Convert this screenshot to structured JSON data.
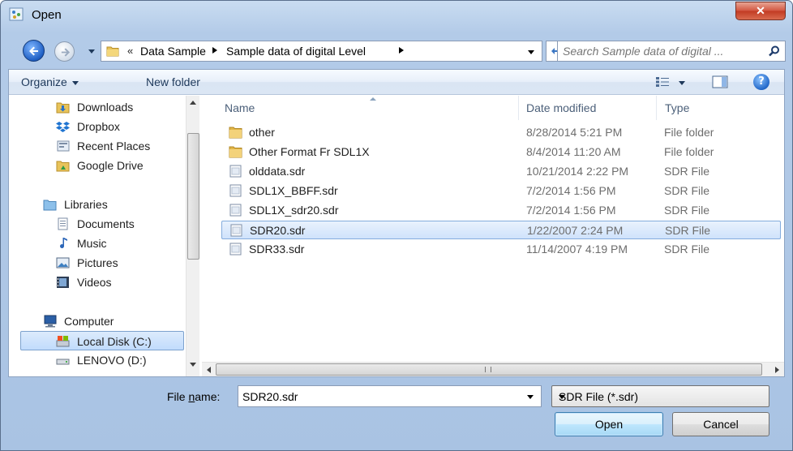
{
  "window": {
    "title": "Open"
  },
  "address": {
    "overflow": "«",
    "crumbs": [
      "Data Sample",
      "Sample data of digital Level"
    ]
  },
  "search": {
    "placeholder": "Search Sample data of digital ..."
  },
  "toolbar": {
    "organize": "Organize",
    "new_folder": "New folder"
  },
  "nav": {
    "items": [
      {
        "label": "Downloads",
        "icon": "downloads-folder-icon"
      },
      {
        "label": "Dropbox",
        "icon": "dropbox-icon"
      },
      {
        "label": "Recent Places",
        "icon": "recent-places-icon"
      },
      {
        "label": "Google Drive",
        "icon": "google-drive-icon"
      },
      {
        "label": "Libraries",
        "icon": "libraries-icon"
      },
      {
        "label": "Documents",
        "icon": "documents-icon"
      },
      {
        "label": "Music",
        "icon": "music-icon"
      },
      {
        "label": "Pictures",
        "icon": "pictures-icon"
      },
      {
        "label": "Videos",
        "icon": "videos-icon"
      },
      {
        "label": "Computer",
        "icon": "computer-icon"
      },
      {
        "label": "Local Disk (C:)",
        "icon": "local-disk-icon"
      },
      {
        "label": "LENOVO (D:)",
        "icon": "drive-icon"
      }
    ]
  },
  "columns": {
    "name": "Name",
    "date": "Date modified",
    "type": "Type"
  },
  "files": [
    {
      "name": "other",
      "date": "8/28/2014 5:21 PM",
      "type": "File folder",
      "icon": "folder-icon"
    },
    {
      "name": "Other Format Fr SDL1X",
      "date": "8/4/2014 11:20 AM",
      "type": "File folder",
      "icon": "folder-icon"
    },
    {
      "name": "olddata.sdr",
      "date": "10/21/2014 2:22 PM",
      "type": "SDR File",
      "icon": "file-icon"
    },
    {
      "name": "SDL1X_BBFF.sdr",
      "date": "7/2/2014 1:56 PM",
      "type": "SDR File",
      "icon": "file-icon"
    },
    {
      "name": "SDL1X_sdr20.sdr",
      "date": "7/2/2014 1:56 PM",
      "type": "SDR File",
      "icon": "file-icon"
    },
    {
      "name": "SDR20.sdr",
      "date": "1/22/2007 2:24 PM",
      "type": "SDR File",
      "icon": "file-icon",
      "selected": true
    },
    {
      "name": "SDR33.sdr",
      "date": "11/14/2007 4:19 PM",
      "type": "SDR File",
      "icon": "file-icon"
    }
  ],
  "footer": {
    "filename_label_pre": "File ",
    "filename_label_mnemonic": "n",
    "filename_label_post": "ame:",
    "filename_value": "SDR20.sdr",
    "filetype": "SDR File (*.sdr)",
    "open": "Open",
    "cancel": "Cancel"
  },
  "colors": {
    "selection": "#cfe2fb",
    "accent": "#1e395b"
  }
}
